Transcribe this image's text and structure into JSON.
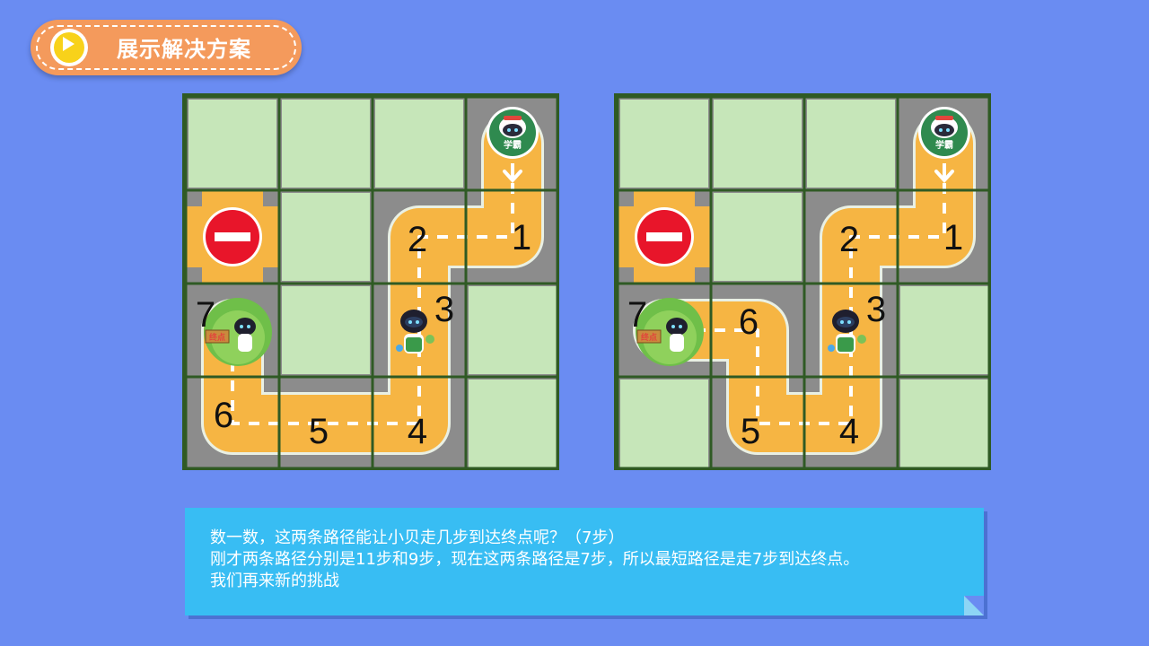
{
  "header": {
    "button_label": "展示解决方案",
    "icon": "play-icon"
  },
  "boards": [
    {
      "steps": [
        {
          "label": "1",
          "cell": [
            1,
            3
          ]
        },
        {
          "label": "2",
          "cell": [
            1,
            2
          ]
        },
        {
          "label": "3",
          "cell": [
            2,
            2
          ]
        },
        {
          "label": "4",
          "cell": [
            3,
            2
          ]
        },
        {
          "label": "5",
          "cell": [
            3,
            1
          ]
        },
        {
          "label": "6",
          "cell": [
            3,
            0
          ]
        },
        {
          "label": "7",
          "cell": [
            2,
            0
          ]
        }
      ]
    },
    {
      "steps": [
        {
          "label": "1",
          "cell": [
            1,
            3
          ]
        },
        {
          "label": "2",
          "cell": [
            1,
            2
          ]
        },
        {
          "label": "3",
          "cell": [
            2,
            2
          ]
        },
        {
          "label": "4",
          "cell": [
            3,
            2
          ]
        },
        {
          "label": "5",
          "cell": [
            3,
            1
          ]
        },
        {
          "label": "6",
          "cell": [
            2,
            1
          ]
        },
        {
          "label": "7",
          "cell": [
            2,
            0
          ]
        }
      ]
    }
  ],
  "icons": {
    "start": "robot-start-icon",
    "blocked": "no-entry-icon",
    "goal": "finish-flag-icon",
    "character": "robot-character-icon"
  },
  "goal_sign_text": "终点",
  "robot_badge_text": "学霸",
  "info": {
    "line1": "数一数，这两条路径能让小贝走几步到达终点呢？（7步）",
    "line2": "刚才两条路径分别是11步和9步，现在这两条路径是7步，所以最短路径是走7步到达终点。",
    "line3": "我们再来新的挑战"
  },
  "colors": {
    "background": "#6a8cf2",
    "road": "#f6b543",
    "grass": "#c6e6b9",
    "grid_border": "#2f5a24",
    "asphalt": "#8c8c8c",
    "panel": "#38bdf3",
    "header_button": "#f49a5c"
  }
}
